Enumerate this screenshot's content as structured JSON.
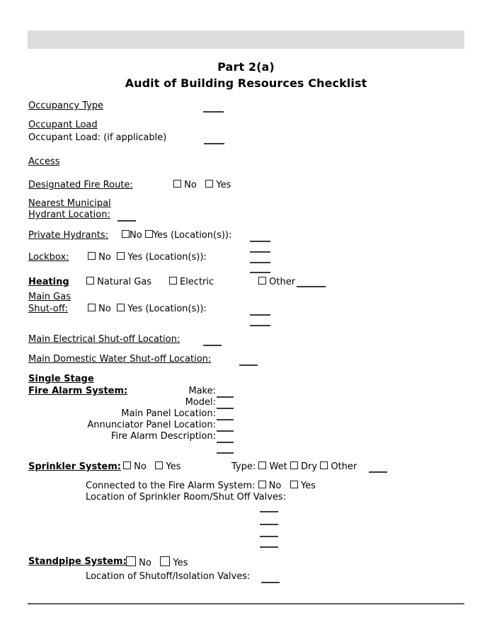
{
  "document": {
    "title_line1": "Part 2(a)",
    "title_line2": "Audit of Building Resources Checklist"
  },
  "fields": {
    "occupancy_type": "Occupancy Type",
    "occupant_load_heading": "Occupant Load",
    "occupant_load_sub": "Occupant Load: (if applicable)",
    "access_heading": "Access",
    "designated_fire_route": "Designated Fire Route:",
    "nearest_municipal": "Nearest Municipal",
    "hydrant_location": "Hydrant Location:",
    "private_hydrants": "Private Hydrants:",
    "lockbox": "Lockbox:",
    "heating": "Heating",
    "main_gas": "Main Gas",
    "shut_off": "Shut-off:",
    "main_electrical": "Main Electrical Shut-off Location:",
    "main_domestic_water": "Main Domestic Water Shut-off Location:",
    "single_stage": "Single Stage",
    "fire_alarm_system": "Fire Alarm System:",
    "sprinkler_system": "Sprinkler System:",
    "connected_to_fas": "Connected to the Fire Alarm System:",
    "location_sprinkler_room": "Location of Sprinkler Room/Shut Off Valves:",
    "standpipe_system": "Standpipe System:",
    "location_shutoff_valves": "Location of Shutoff/Isolation Valves:"
  },
  "options": {
    "no": "No",
    "yes": "Yes",
    "yes_locations": "Yes (Location(s)):",
    "natural_gas": "Natural Gas",
    "electric": "Electric",
    "other": "Other",
    "type_label": "Type:",
    "wet": "Wet",
    "dry": "Dry"
  },
  "fire_alarm_labels": {
    "make": "Make:",
    "model": "Model:",
    "main_panel_location": "Main Panel Location:",
    "annunciator_panel_location": "Annunciator Panel Location:",
    "fire_alarm_description": "Fire Alarm Description:"
  },
  "colors": {
    "header_band": "#dddddd",
    "rule": "#5b5b5b",
    "fill_line": "#3a3a3a",
    "text": "#000000"
  }
}
